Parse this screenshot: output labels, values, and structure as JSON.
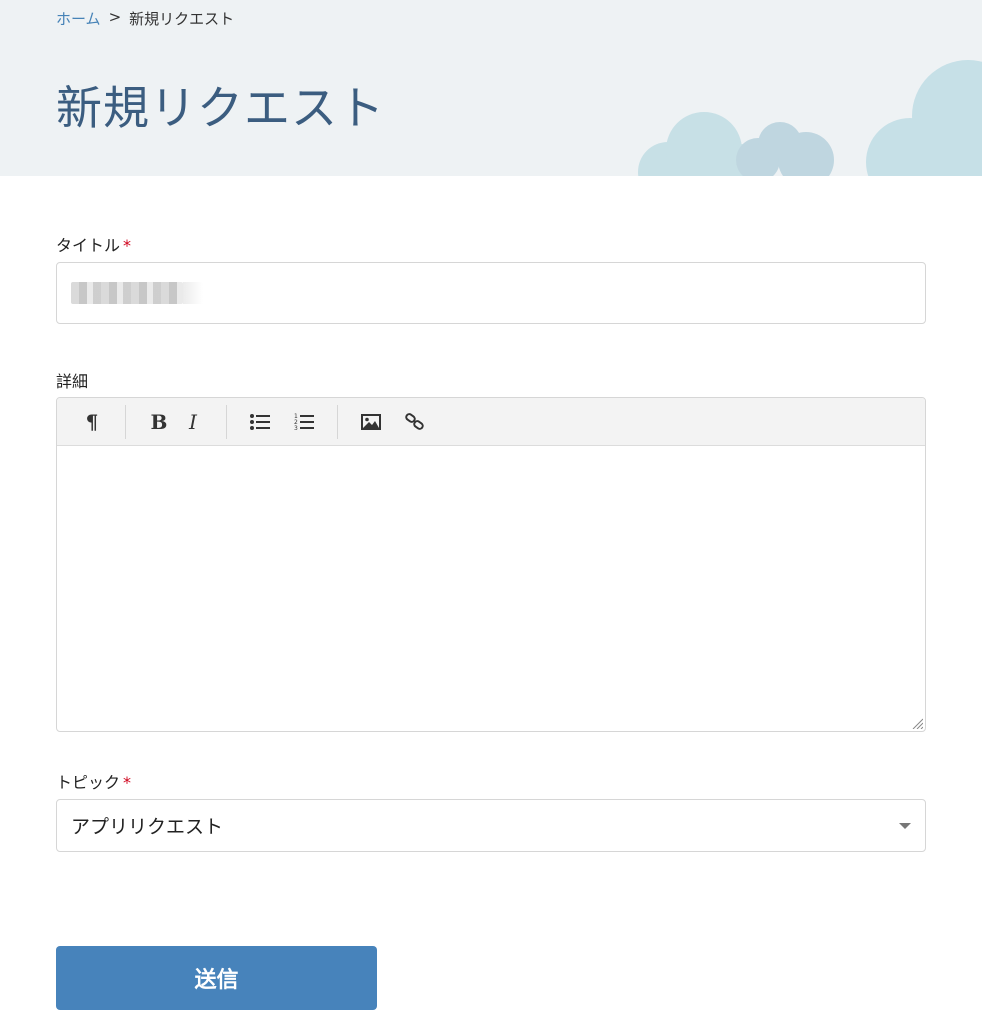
{
  "breadcrumb": {
    "home_label": "ホーム",
    "separator": ">",
    "current_label": "新規リクエスト"
  },
  "page": {
    "title": "新規リクエスト"
  },
  "form": {
    "title_field": {
      "label": "タイトル",
      "required_mark": "*",
      "value_redacted": true
    },
    "details_field": {
      "label": "詳細",
      "toolbar_icons": [
        "paragraph-icon",
        "bold-icon",
        "italic-icon",
        "bullet-list-icon",
        "numbered-list-icon",
        "image-icon",
        "link-icon"
      ],
      "bold_glyph": "B",
      "italic_glyph": "I",
      "paragraph_glyph": "¶",
      "value": ""
    },
    "topic_field": {
      "label": "トピック",
      "required_mark": "*",
      "selected": "アプリリクエスト"
    },
    "submit_label": "送信"
  },
  "colors": {
    "accent": "#4783bb",
    "link": "#4683b7",
    "title": "#3b5d80",
    "hero_bg": "#eef2f4",
    "required": "#d0021b"
  }
}
